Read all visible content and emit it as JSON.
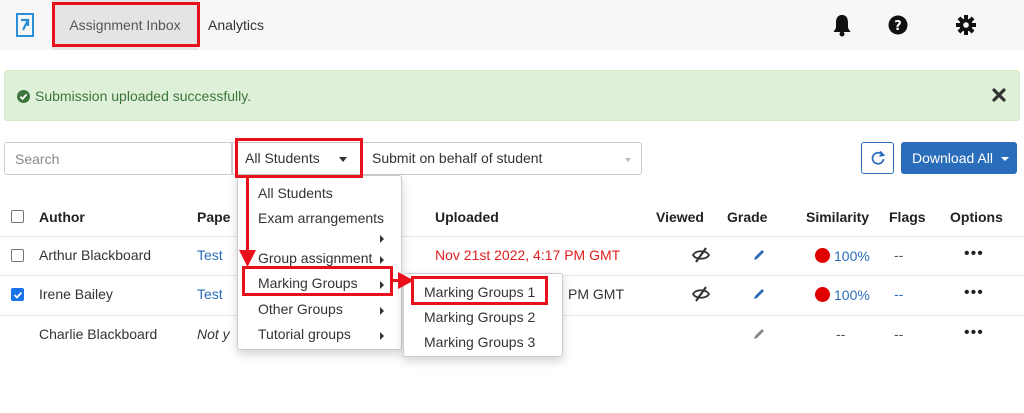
{
  "nav": {
    "tabs": [
      {
        "label": "Assignment Inbox"
      },
      {
        "label": "Analytics"
      }
    ],
    "icons": [
      "logo-icon",
      "bell-icon",
      "help-icon",
      "gear-icon"
    ]
  },
  "alert": {
    "message": "Submission uploaded successfully."
  },
  "toolbar": {
    "search_placeholder": "Search",
    "filter_selected": "All Students",
    "behalf_label": "Submit on behalf of student",
    "download_label": "Download All"
  },
  "table": {
    "headers": {
      "author": "Author",
      "paper": "Pape",
      "uploaded": "Uploaded",
      "viewed": "Viewed",
      "grade": "Grade",
      "similarity": "Similarity",
      "flags": "Flags",
      "options": "Options"
    },
    "rows": [
      {
        "author": "Arthur Blackboard",
        "paper": "Test",
        "uploaded": "Nov 21st 2022, 4:17 PM GMT",
        "similarity": "100%",
        "flags": "--",
        "checked": false
      },
      {
        "author": "Irene Bailey",
        "paper": "Test",
        "uploaded": "PM GMT",
        "similarity": "100%",
        "flags": "--",
        "checked": true
      },
      {
        "author": "Charlie Blackboard",
        "paper": "Not y",
        "uploaded": "",
        "similarity": "--",
        "flags": "--",
        "checked": null
      }
    ],
    "options_glyph": "•••"
  },
  "filter_menu": {
    "items": [
      "All Students",
      "Exam arrangements",
      "Group assignment",
      "Marking Groups",
      "Other Groups",
      "Tutorial groups"
    ]
  },
  "submenu": {
    "items": [
      "Marking Groups 1",
      "Marking Groups 2",
      "Marking Groups 3"
    ]
  },
  "colors": {
    "accent": "#2a6ebb",
    "highlight": "#e8101a",
    "success_bg": "#dff0d8"
  }
}
